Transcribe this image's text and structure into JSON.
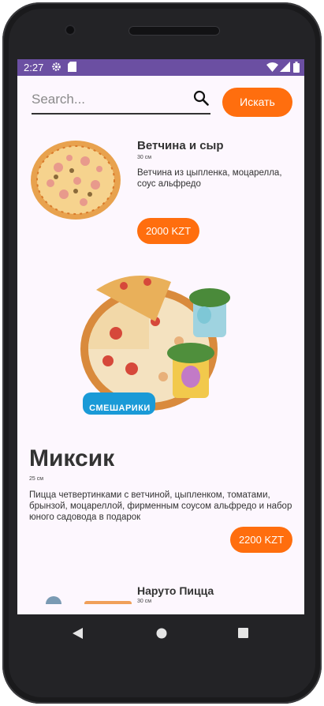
{
  "status_bar": {
    "time": "2:27",
    "icons": [
      "gear-icon",
      "sd-card-icon",
      "wifi-icon",
      "signal-icon",
      "battery-icon"
    ],
    "color": "#6b4fa2"
  },
  "search": {
    "placeholder": "Search...",
    "value": "",
    "button_label": "Искать"
  },
  "products": [
    {
      "name": "Ветчина и сыр",
      "size": "30 см",
      "description": "Ветчина из цыпленка, моцарелла, соус альфредо",
      "price": "2000 KZT"
    },
    {
      "name": "Миксик",
      "size": "25 см",
      "description": "Пицца четвертинками с ветчиной, цыпленком, томатами, брынзой, моцареллой, фирменным соусом альфредо и набор юного садовода в подарок",
      "price": "2200 KZT",
      "brand_logo": "СМЕШАРИКИ"
    },
    {
      "name": "Наруто Пицца",
      "size": "30 см"
    }
  ],
  "nav": {
    "buttons": [
      "back-icon",
      "home-icon",
      "recents-icon"
    ]
  },
  "colors": {
    "accent": "#ff6e0e",
    "background": "#fdf7fe"
  }
}
